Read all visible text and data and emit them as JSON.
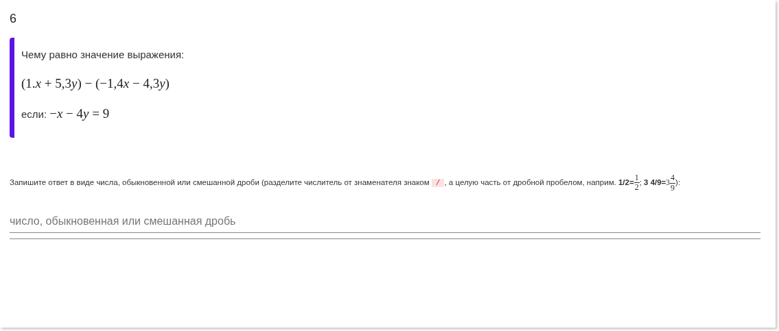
{
  "question_number": "6",
  "question": {
    "prompt": "Чему равно значение выражения:",
    "expression": "(1.x + 5,3y) − (−1,4x − 4,3y)",
    "condition_label": "если:",
    "condition": "−x − 4y = 9"
  },
  "hint": [
    {
      "kind": "text",
      "text": "Запишите ответ в виде числа, обыкновенной или смешанной дроби (разделите числитель от знаменателя знаком "
    },
    {
      "kind": "code",
      "text": "/"
    },
    {
      "kind": "text",
      "text": ", а целую часть от дробной пробелом, наприм. "
    },
    {
      "kind": "bold",
      "text": "1/2="
    },
    {
      "kind": "frac",
      "numerator": "1",
      "denominator": "2"
    },
    {
      "kind": "text",
      "text": "; "
    },
    {
      "kind": "bold",
      "text": "3 4/9="
    },
    {
      "kind": "mixed",
      "whole": "3",
      "numerator": "4",
      "denominator": "9"
    },
    {
      "kind": "text",
      "text": "):"
    }
  ],
  "answer": {
    "placeholder": "число, обыкновенная или смешанная дробь"
  }
}
